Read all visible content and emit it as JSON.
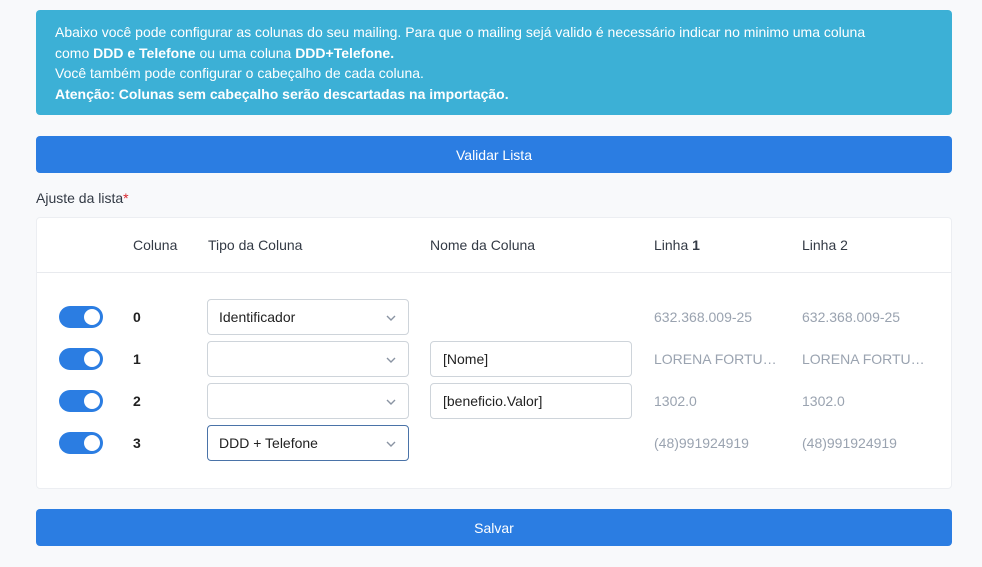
{
  "alert": {
    "line1a": "Abaixo você pode configurar as colunas do seu mailing. Para que o mailing sejá valido é necessário indicar no minimo uma coluna",
    "line2a": "como ",
    "line2b": "DDD e Telefone",
    "line2c": " ou uma coluna ",
    "line2d": "DDD+Telefone.",
    "line3": "Você também pode configurar o cabeçalho de cada coluna.",
    "line4": "Atenção: Colunas sem cabeçalho serão descartadas na importação."
  },
  "validate_button": "Validar Lista",
  "section_label": "Ajuste da lista",
  "required_mark": "*",
  "table": {
    "headers": {
      "coluna": "Coluna",
      "tipo": "Tipo da Coluna",
      "nome": "Nome da Coluna",
      "linha1_text": "Linha ",
      "linha1_num": "1",
      "linha2": "Linha 2"
    },
    "rows": [
      {
        "enabled": true,
        "coluna": "0",
        "tipo": "Identificador",
        "nome": null,
        "linha1": "632.368.009-25",
        "linha2": "632.368.009-25"
      },
      {
        "enabled": true,
        "coluna": "1",
        "tipo": "",
        "nome": "[Nome]",
        "linha1": "LORENA FORTUNATO",
        "linha2": "LORENA FORTUNATO"
      },
      {
        "enabled": true,
        "coluna": "2",
        "tipo": "",
        "nome": "[beneficio.Valor]",
        "linha1": "1302.0",
        "linha2": "1302.0"
      },
      {
        "enabled": true,
        "coluna": "3",
        "tipo": "DDD + Telefone",
        "nome": null,
        "linha1": "(48)991924919",
        "linha2": "(48)991924919"
      }
    ]
  },
  "save_button": "Salvar",
  "colors": {
    "primary": "#2b7de2",
    "info": "#3cb0d6"
  }
}
